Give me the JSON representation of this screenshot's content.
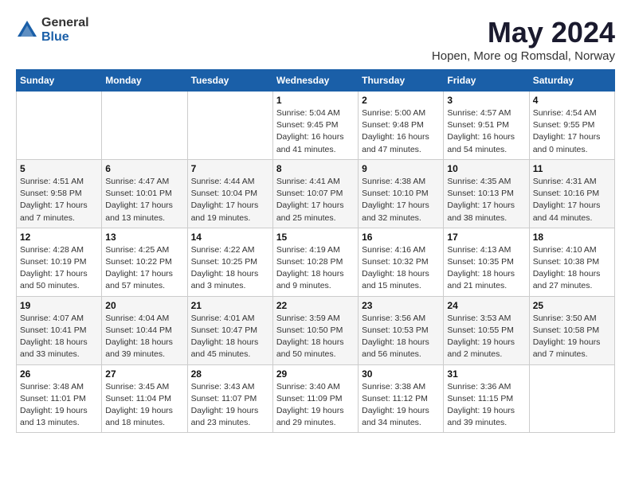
{
  "logo": {
    "general": "General",
    "blue": "Blue"
  },
  "title": "May 2024",
  "location": "Hopen, More og Romsdal, Norway",
  "weekdays": [
    "Sunday",
    "Monday",
    "Tuesday",
    "Wednesday",
    "Thursday",
    "Friday",
    "Saturday"
  ],
  "weeks": [
    [
      {
        "day": "",
        "info": ""
      },
      {
        "day": "",
        "info": ""
      },
      {
        "day": "",
        "info": ""
      },
      {
        "day": "1",
        "info": "Sunrise: 5:04 AM\nSunset: 9:45 PM\nDaylight: 16 hours and 41 minutes."
      },
      {
        "day": "2",
        "info": "Sunrise: 5:00 AM\nSunset: 9:48 PM\nDaylight: 16 hours and 47 minutes."
      },
      {
        "day": "3",
        "info": "Sunrise: 4:57 AM\nSunset: 9:51 PM\nDaylight: 16 hours and 54 minutes."
      },
      {
        "day": "4",
        "info": "Sunrise: 4:54 AM\nSunset: 9:55 PM\nDaylight: 17 hours and 0 minutes."
      }
    ],
    [
      {
        "day": "5",
        "info": "Sunrise: 4:51 AM\nSunset: 9:58 PM\nDaylight: 17 hours and 7 minutes."
      },
      {
        "day": "6",
        "info": "Sunrise: 4:47 AM\nSunset: 10:01 PM\nDaylight: 17 hours and 13 minutes."
      },
      {
        "day": "7",
        "info": "Sunrise: 4:44 AM\nSunset: 10:04 PM\nDaylight: 17 hours and 19 minutes."
      },
      {
        "day": "8",
        "info": "Sunrise: 4:41 AM\nSunset: 10:07 PM\nDaylight: 17 hours and 25 minutes."
      },
      {
        "day": "9",
        "info": "Sunrise: 4:38 AM\nSunset: 10:10 PM\nDaylight: 17 hours and 32 minutes."
      },
      {
        "day": "10",
        "info": "Sunrise: 4:35 AM\nSunset: 10:13 PM\nDaylight: 17 hours and 38 minutes."
      },
      {
        "day": "11",
        "info": "Sunrise: 4:31 AM\nSunset: 10:16 PM\nDaylight: 17 hours and 44 minutes."
      }
    ],
    [
      {
        "day": "12",
        "info": "Sunrise: 4:28 AM\nSunset: 10:19 PM\nDaylight: 17 hours and 50 minutes."
      },
      {
        "day": "13",
        "info": "Sunrise: 4:25 AM\nSunset: 10:22 PM\nDaylight: 17 hours and 57 minutes."
      },
      {
        "day": "14",
        "info": "Sunrise: 4:22 AM\nSunset: 10:25 PM\nDaylight: 18 hours and 3 minutes."
      },
      {
        "day": "15",
        "info": "Sunrise: 4:19 AM\nSunset: 10:28 PM\nDaylight: 18 hours and 9 minutes."
      },
      {
        "day": "16",
        "info": "Sunrise: 4:16 AM\nSunset: 10:32 PM\nDaylight: 18 hours and 15 minutes."
      },
      {
        "day": "17",
        "info": "Sunrise: 4:13 AM\nSunset: 10:35 PM\nDaylight: 18 hours and 21 minutes."
      },
      {
        "day": "18",
        "info": "Sunrise: 4:10 AM\nSunset: 10:38 PM\nDaylight: 18 hours and 27 minutes."
      }
    ],
    [
      {
        "day": "19",
        "info": "Sunrise: 4:07 AM\nSunset: 10:41 PM\nDaylight: 18 hours and 33 minutes."
      },
      {
        "day": "20",
        "info": "Sunrise: 4:04 AM\nSunset: 10:44 PM\nDaylight: 18 hours and 39 minutes."
      },
      {
        "day": "21",
        "info": "Sunrise: 4:01 AM\nSunset: 10:47 PM\nDaylight: 18 hours and 45 minutes."
      },
      {
        "day": "22",
        "info": "Sunrise: 3:59 AM\nSunset: 10:50 PM\nDaylight: 18 hours and 50 minutes."
      },
      {
        "day": "23",
        "info": "Sunrise: 3:56 AM\nSunset: 10:53 PM\nDaylight: 18 hours and 56 minutes."
      },
      {
        "day": "24",
        "info": "Sunrise: 3:53 AM\nSunset: 10:55 PM\nDaylight: 19 hours and 2 minutes."
      },
      {
        "day": "25",
        "info": "Sunrise: 3:50 AM\nSunset: 10:58 PM\nDaylight: 19 hours and 7 minutes."
      }
    ],
    [
      {
        "day": "26",
        "info": "Sunrise: 3:48 AM\nSunset: 11:01 PM\nDaylight: 19 hours and 13 minutes."
      },
      {
        "day": "27",
        "info": "Sunrise: 3:45 AM\nSunset: 11:04 PM\nDaylight: 19 hours and 18 minutes."
      },
      {
        "day": "28",
        "info": "Sunrise: 3:43 AM\nSunset: 11:07 PM\nDaylight: 19 hours and 23 minutes."
      },
      {
        "day": "29",
        "info": "Sunrise: 3:40 AM\nSunset: 11:09 PM\nDaylight: 19 hours and 29 minutes."
      },
      {
        "day": "30",
        "info": "Sunrise: 3:38 AM\nSunset: 11:12 PM\nDaylight: 19 hours and 34 minutes."
      },
      {
        "day": "31",
        "info": "Sunrise: 3:36 AM\nSunset: 11:15 PM\nDaylight: 19 hours and 39 minutes."
      },
      {
        "day": "",
        "info": ""
      }
    ]
  ]
}
